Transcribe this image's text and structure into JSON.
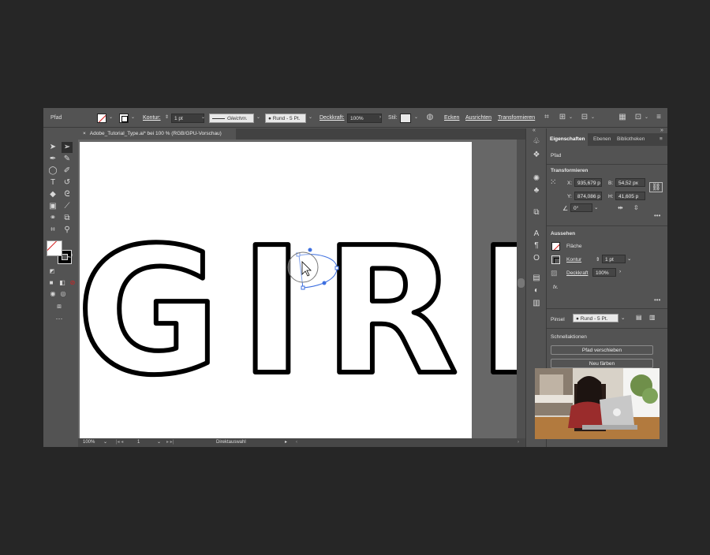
{
  "control_bar": {
    "selection_type": "Pfad",
    "kontur_label": "Kontur:",
    "kontur_value": "1 pt",
    "stroke_profile": "Gleichm.",
    "brush": "Rund - 5 Pt.",
    "deckkraft_label": "Deckkraft:",
    "deckkraft_value": "100%",
    "stil_label": "Stil:",
    "ecken": "Ecken",
    "ausrichten": "Ausrichten",
    "transformieren": "Transformieren"
  },
  "document": {
    "tab_title": "Adobe_Tutorial_Type.ai* bei 100 % (RGB/GPU-Vorschau)",
    "close_glyph": "×"
  },
  "artwork": {
    "word": "GIRL"
  },
  "status_bar": {
    "zoom": "100%",
    "artboard_number": "1",
    "current_tool": "Direktauswahl"
  },
  "properties_panel": {
    "tabs": [
      "Eigenschaften",
      "Ebenen",
      "Bibliotheken"
    ],
    "object_type": "Pfad",
    "transform_heading": "Transformieren",
    "x_label": "X:",
    "x_value": "935,679 p",
    "y_label": "Y:",
    "y_value": "874,086 p",
    "b_label": "B:",
    "b_value": "54,52 px",
    "h_label": "H:",
    "h_value": "41,605 p",
    "angle_value": "0°",
    "appearance_heading": "Aussehen",
    "fill_label": "Fläche",
    "stroke_label": "Kontur",
    "stroke_value": "1 pt",
    "opacity_label": "Deckkraft",
    "opacity_value": "100%",
    "fx_label": "fx.",
    "brush_label": "Pinsel",
    "brush_value": "Rund - 5 Pt.",
    "quick_actions_heading": "Schnellaktionen",
    "offset_path_button": "Pfad verschieben",
    "recolor_button": "Neu färben"
  },
  "colors": {
    "ui_dark": "#535353",
    "pasteboard": "#676767",
    "artboard": "#ffffff",
    "selection_blue": "#3d6fe0",
    "none_red": "#d62020"
  }
}
